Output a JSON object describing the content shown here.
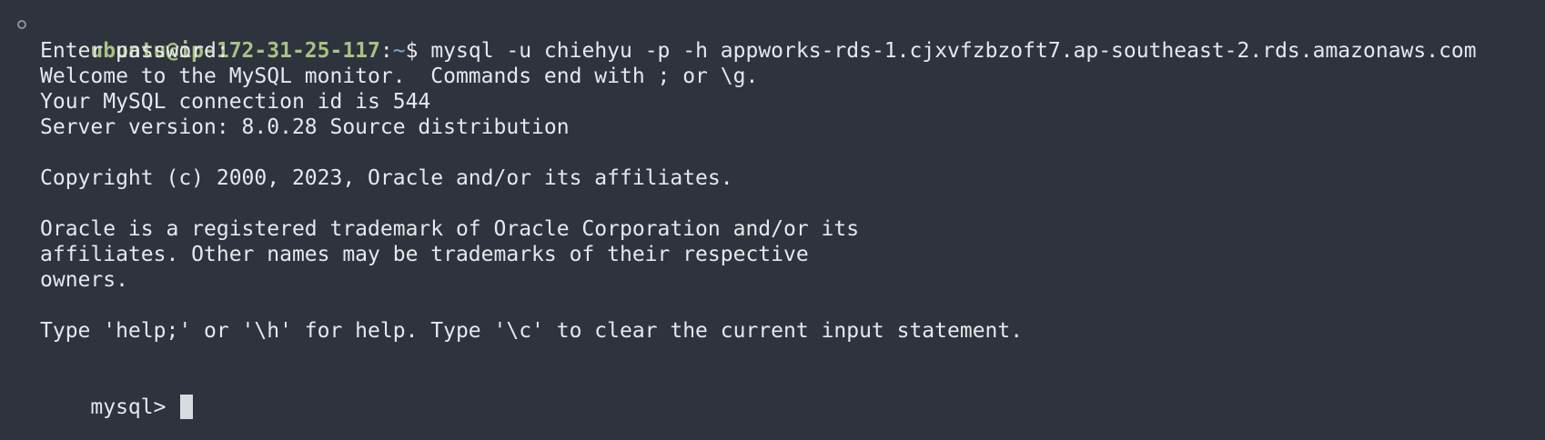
{
  "colors": {
    "background": "#2f333d",
    "text": "#e6e8ec",
    "user_host": "#a8c283",
    "path": "#7fa9d6",
    "cursor": "#d8dbe0"
  },
  "prompt": {
    "user_host": "ubuntu@ip-172-31-25-117",
    "separator": ":",
    "path": "~",
    "symbol": "$ ",
    "command": "mysql -u chiehyu -p -h appworks-rds-1.cjxvfzbzoft7.ap-southeast-2.rds.amazonaws.com"
  },
  "output_lines": [
    "Enter password:",
    "Welcome to the MySQL monitor.  Commands end with ; or \\g.",
    "Your MySQL connection id is 544",
    "Server version: 8.0.28 Source distribution",
    "",
    "Copyright (c) 2000, 2023, Oracle and/or its affiliates.",
    "",
    "Oracle is a registered trademark of Oracle Corporation and/or its",
    "affiliates. Other names may be trademarks of their respective",
    "owners.",
    "",
    "Type 'help;' or '\\h' for help. Type '\\c' to clear the current input statement.",
    ""
  ],
  "mysql_prompt": "mysql> "
}
